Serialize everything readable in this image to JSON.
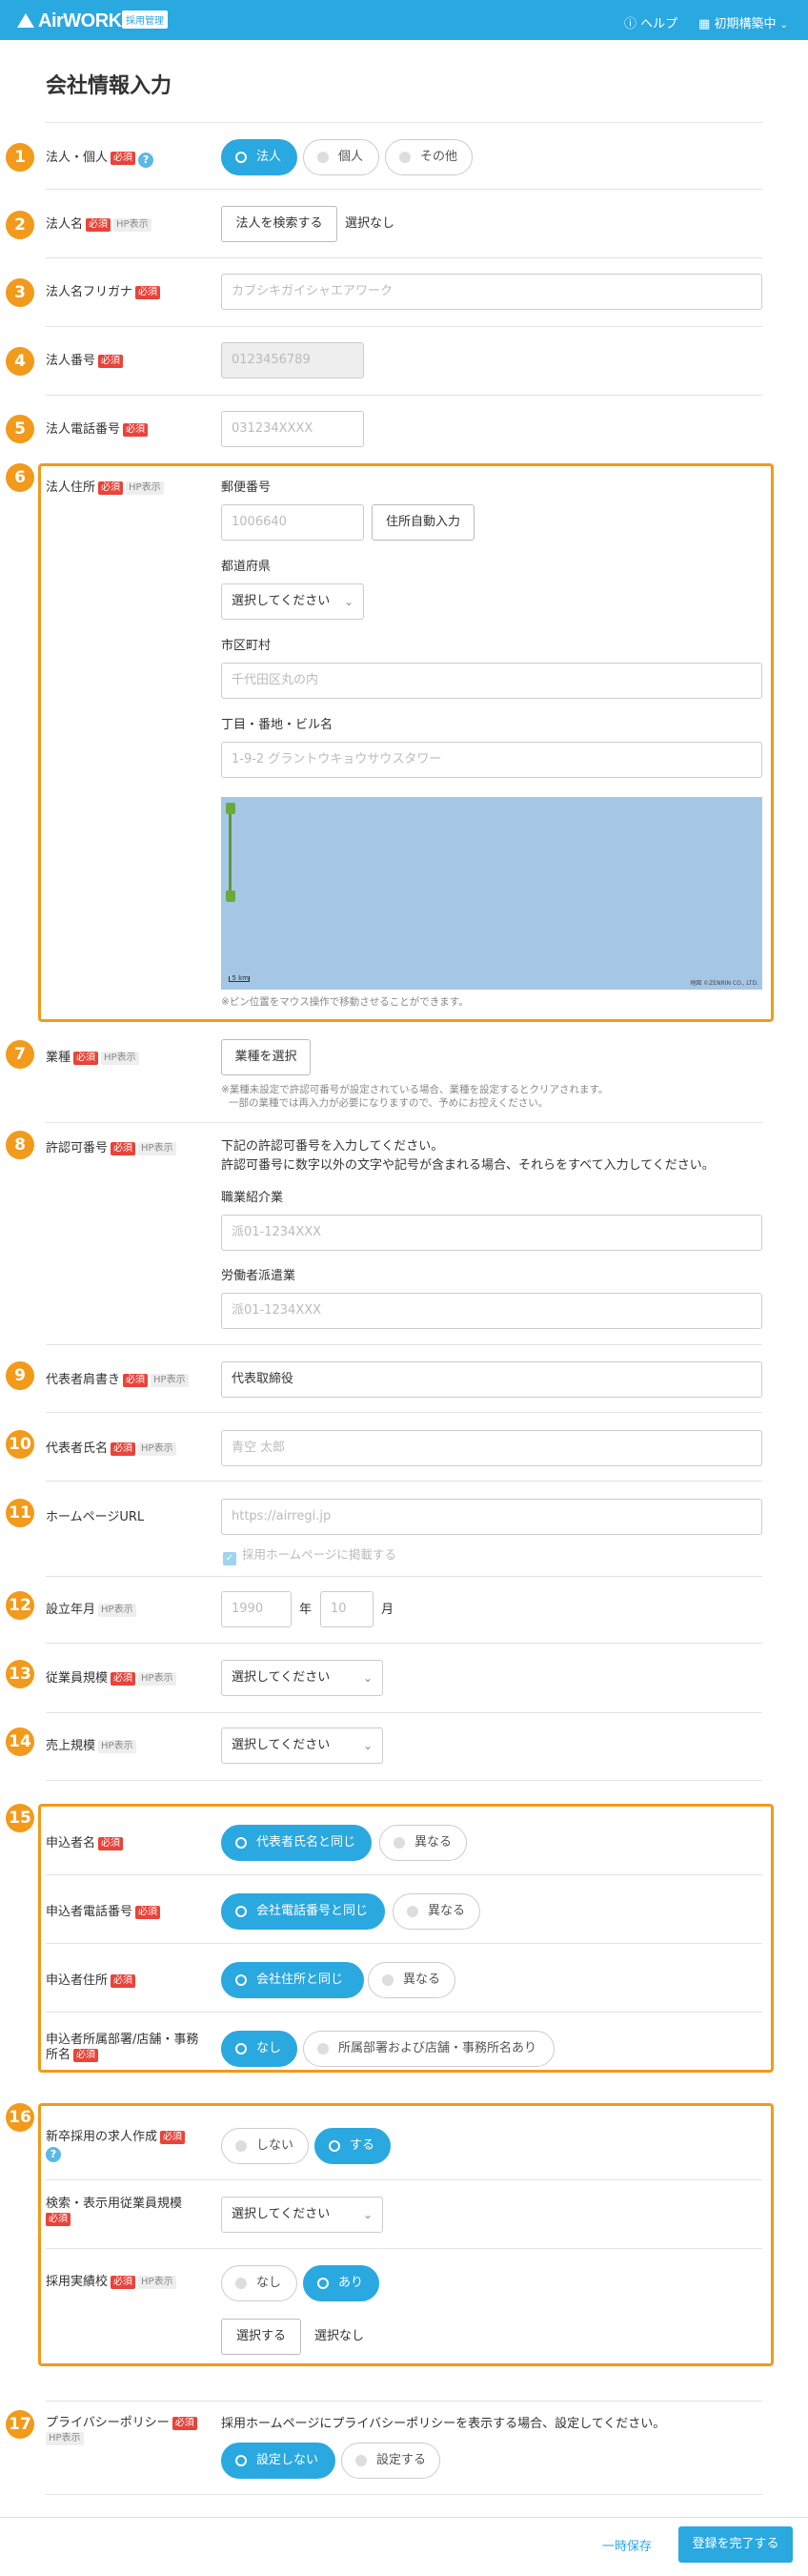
{
  "header": {
    "logo": "AirWORK",
    "badge": "採用管理",
    "help": "ヘルプ",
    "setup": "初期構築中"
  },
  "title": "会社情報入力",
  "badges": {
    "required": "必須",
    "hp": "HP表示"
  },
  "steps": [
    "1",
    "2",
    "3",
    "4",
    "5",
    "6",
    "7",
    "8",
    "9",
    "10",
    "11",
    "12",
    "13",
    "14",
    "15",
    "16",
    "17"
  ],
  "s1": {
    "label": "法人・個人",
    "options": [
      "法人",
      "個人",
      "その他"
    ]
  },
  "s2": {
    "label": "法人名",
    "button": "法人を検索する",
    "status": "選択なし"
  },
  "s3": {
    "label": "法人名フリガナ",
    "placeholder": "カブシキガイシャエアワーク"
  },
  "s4": {
    "label": "法人番号",
    "placeholder": "0123456789"
  },
  "s5": {
    "label": "法人電話番号",
    "placeholder": "031234XXXX"
  },
  "s6": {
    "label": "法人住所",
    "postal_label": "郵便番号",
    "postal_placeholder": "1006640",
    "auto_button": "住所自動入力",
    "pref_label": "都道府県",
    "pref_value": "選択してください",
    "city_label": "市区町村",
    "city_placeholder": "千代田区丸の内",
    "street_label": "丁目・番地・ビル名",
    "street_placeholder": "1-9-2 グラントウキョウサウスタワー",
    "map_scale": "5 km",
    "map_copyright": "地図 ©ZENRIN CO., LTD.",
    "map_note": "※ピン位置をマウス操作で移動させることができます。"
  },
  "s7": {
    "label": "業種",
    "button": "業種を選択",
    "note1": "※業種未設定で許認可番号が設定されている場合、業種を設定するとクリアされます。",
    "note2": "一部の業種では再入力が必要になりますので、予めにお控えください。"
  },
  "s8": {
    "label": "許認可番号",
    "desc1": "下記の許認可番号を入力してください。",
    "desc2": "許認可番号に数字以外の文字や記号が含まれる場合、それらをすべて入力してください。",
    "f1_label": "職業紹介業",
    "f1_placeholder": "派01-1234XXX",
    "f2_label": "労働者派遣業",
    "f2_placeholder": "派01-1234XXX"
  },
  "s9": {
    "label": "代表者肩書き",
    "value": "代表取締役"
  },
  "s10": {
    "label": "代表者氏名",
    "placeholder": "青空 太郎"
  },
  "s11": {
    "label": "ホームページURL",
    "placeholder": "https://airregi.jp",
    "checkbox": "採用ホームページに掲載する"
  },
  "s12": {
    "label": "設立年月",
    "year_placeholder": "1990",
    "year_unit": "年",
    "month_placeholder": "10",
    "month_unit": "月"
  },
  "s13": {
    "label": "従業員規模",
    "value": "選択してください"
  },
  "s14": {
    "label": "売上規模",
    "value": "選択してください"
  },
  "s15": {
    "r1_label": "申込者名",
    "r1_options": [
      "代表者氏名と同じ",
      "異なる"
    ],
    "r2_label": "申込者電話番号",
    "r2_options": [
      "会社電話番号と同じ",
      "異なる"
    ],
    "r3_label": "申込者住所",
    "r3_options": [
      "会社住所と同じ",
      "異なる"
    ],
    "r4_label_a": "申込者所属部署/店舗・事務",
    "r4_label_b": "所名",
    "r4_options": [
      "なし",
      "所属部署および店舗・事務所名あり"
    ]
  },
  "s16": {
    "r1_label": "新卒採用の求人作成",
    "r1_options": [
      "しない",
      "する"
    ],
    "r2_label": "検索・表示用従業員規模",
    "r2_value": "選択してください",
    "r3_label": "採用実績校",
    "r3_options": [
      "なし",
      "あり"
    ],
    "r3_button": "選択する",
    "r3_status": "選択なし"
  },
  "s17": {
    "label": "プライバシーポリシー",
    "desc": "採用ホームページにプライバシーポリシーを表示する場合、設定してください。",
    "options": [
      "設定しない",
      "設定する"
    ]
  },
  "footer": {
    "save": "一時保存",
    "complete": "登録を完了する"
  }
}
